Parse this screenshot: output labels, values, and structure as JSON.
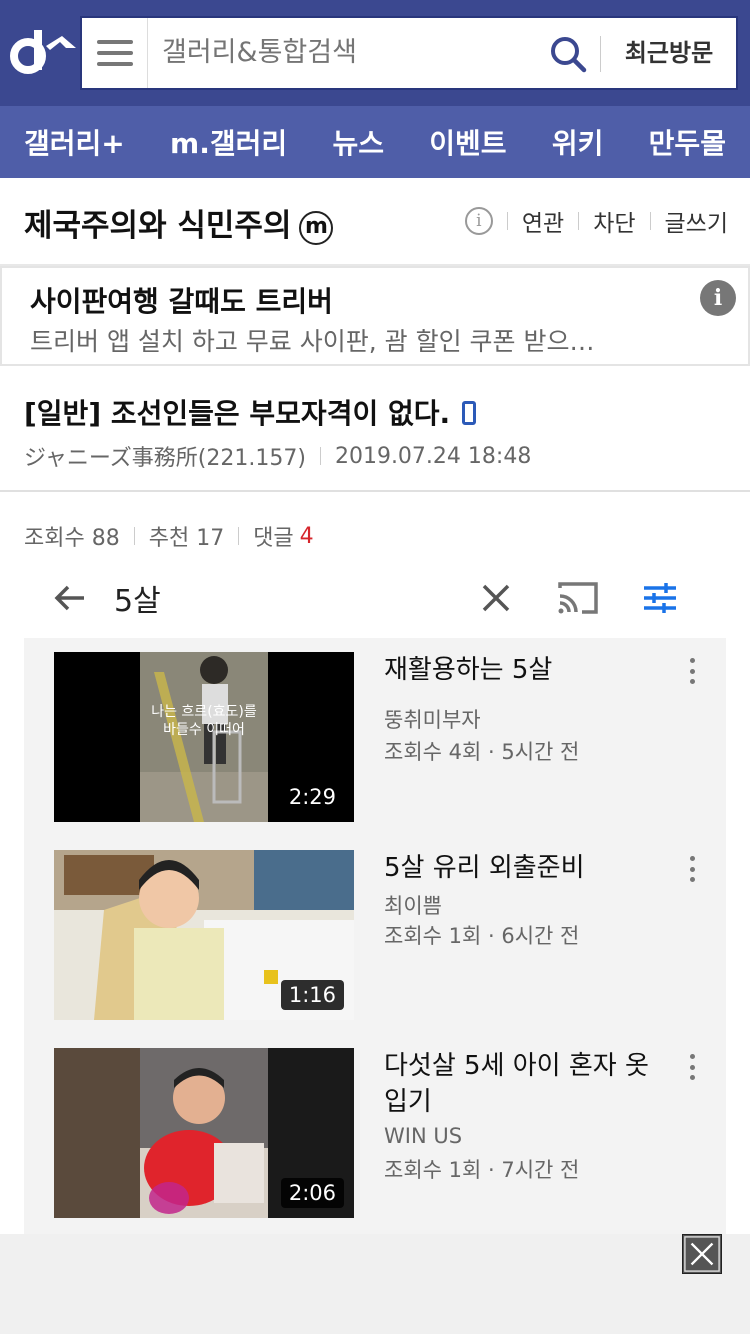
{
  "header": {
    "search_placeholder": "갤러리&통합검색",
    "recent_label": "최근방문"
  },
  "nav": [
    "갤러리+",
    "m.갤러리",
    "뉴스",
    "이벤트",
    "위키",
    "만두몰"
  ],
  "gallery": {
    "title": "제국주의와 식민주의",
    "badge": "m",
    "info_glyph": "i",
    "actions": [
      "연관",
      "차단",
      "글쓰기"
    ]
  },
  "ad": {
    "title": "사이판여행 갈때도 트리버",
    "desc": "트리버 앱 설치 하고 무료 사이판, 괌 할인 쿠폰 받으…",
    "info_glyph": "i"
  },
  "post": {
    "title": "[일반] 조선인들은 부모자격이 없다.",
    "author": "ジャニーズ事務所(221.157)",
    "date": "2019.07.24 18:48",
    "views_label": "조회수 88",
    "recommend_label": "추천 17",
    "comments_label": "댓글",
    "comments_count": "4"
  },
  "youtube": {
    "query": "5살",
    "videos": [
      {
        "title": "재활용하는 5살",
        "channel": "뚱취미부자",
        "meta": "조회수 4회 · 5시간 전",
        "duration": "2:29",
        "caption": "나는 흐르(효도)를\n바들수 이떠어"
      },
      {
        "title": "5살 유리 외출준비",
        "channel": "최이쁨",
        "meta": "조회수 1회 · 6시간 전",
        "duration": "1:16"
      },
      {
        "title": "다섯살 5세 아이 혼자 옷 입기",
        "channel": "WIN US",
        "meta": "조회수 1회 · 7시간 전",
        "duration": "2:06"
      }
    ]
  },
  "colors": {
    "top": "#3b4890",
    "nav": "#4f5ea8",
    "accent": "#2c5ab8",
    "red": "#d6262c"
  }
}
